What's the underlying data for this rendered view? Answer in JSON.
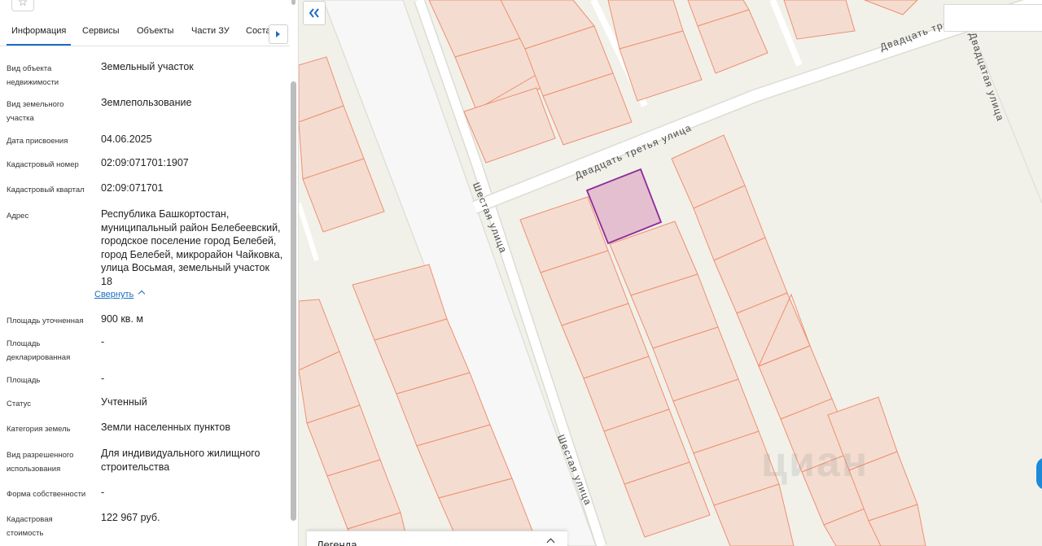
{
  "tabs": [
    {
      "label": "Информация",
      "active": true
    },
    {
      "label": "Сервисы"
    },
    {
      "label": "Объекты"
    },
    {
      "label": "Части ЗУ"
    },
    {
      "label": "Соста"
    }
  ],
  "fields": [
    {
      "label": "Вид объекта недвижимости",
      "value": "Земельный участок"
    },
    {
      "label": "Вид земельного участка",
      "value": "Землепользование"
    },
    {
      "label": "Дата присвоения",
      "value": "04.06.2025"
    },
    {
      "label": "Кадастровый номер",
      "value": "02:09:071701:1907"
    },
    {
      "label": "Кадастровый квартал",
      "value": "02:09:071701"
    },
    {
      "label": "Адрес",
      "value": "Республика Башкортостан, муниципальный район Белебеевский, городское поселение город Белебей, город Белебей, микрорайон Чайковка, улица Восьмая, земельный участок 18"
    },
    {
      "label": "Площадь уточненная",
      "value": "900 кв. м"
    },
    {
      "label": "Площадь декларированная",
      "value": "-"
    },
    {
      "label": "Площадь",
      "value": "-"
    },
    {
      "label": "Статус",
      "value": "Учтенный"
    },
    {
      "label": "Категория земель",
      "value": "Земли населенных пунктов"
    },
    {
      "label": "Вид разрешенного использования",
      "value": "Для индивидуального жилищного строительства"
    },
    {
      "label": "Форма собственности",
      "value": "-"
    },
    {
      "label": "Кадастровая стоимость",
      "value": "122 967 руб."
    }
  ],
  "collapse_link": "Свернуть",
  "map": {
    "streets": {
      "twenty_third": "Двадцать третья улица",
      "twenty_third_top": "Двадцать третья",
      "sixth": "Шестая улица",
      "sixth_lower": "Шестая улица",
      "twentieth": "Двадцатая улица"
    },
    "legend_title": "Легенда",
    "watermark": "циан",
    "colors": {
      "parcel_fill": "#f4ddd0",
      "parcel_stroke": "#ef8f72",
      "selected_fill": "#e3bfcf",
      "selected_stroke": "#8e2a99",
      "road": "#ffffff",
      "background": "#f1f1e9"
    }
  },
  "icons": {
    "favorite": "star-icon",
    "panel_toggle": "double-chevron-left-icon",
    "tabs_scroll": "chevron-right-icon",
    "legend_toggle": "chevron-up-icon"
  }
}
